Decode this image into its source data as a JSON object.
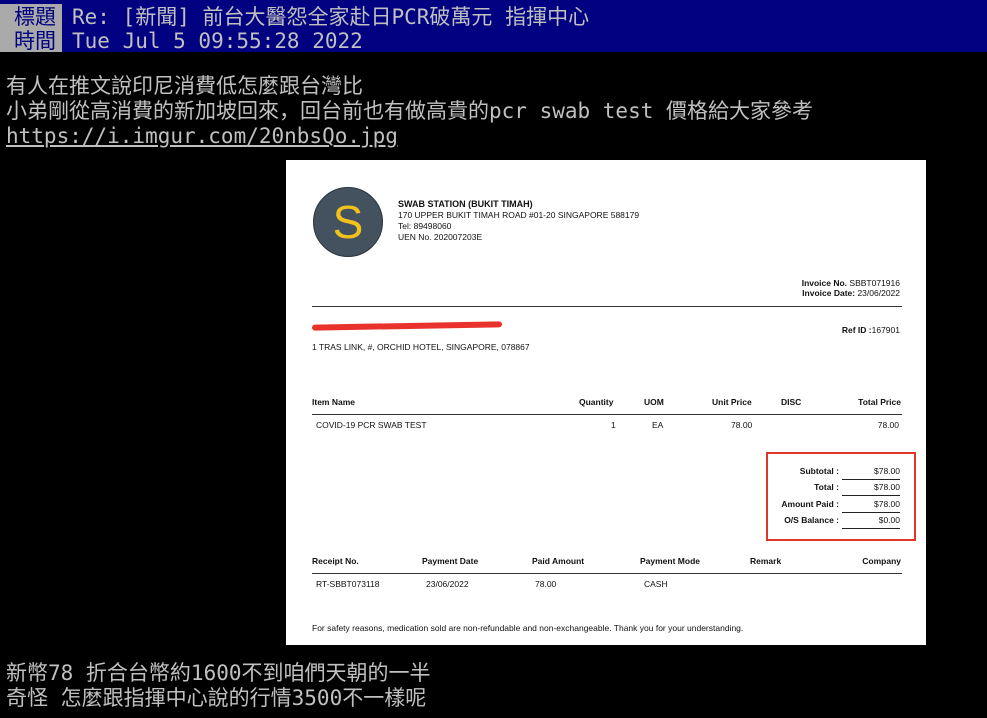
{
  "header": {
    "partial_row": "                              ",
    "title_key": "標題",
    "title_value": "Re: [新聞] 前台大醫怨全家赴日PCR破萬元  指揮中心",
    "time_key": "時間",
    "time_value": "Tue Jul  5 09:55:28 2022"
  },
  "post": {
    "line1": "有人在推文說印尼消費低怎麼跟台灣比",
    "line2": "小弟剛從高消費的新加坡回來，回台前也有做高貴的pcr swab test 價格給大家參考",
    "link": "https://i.imgur.com/20nbsQo.jpg",
    "line4": "新幣78 折合台幣約1600不到咱們天朝的一半",
    "line5": "奇怪 怎麼跟指揮中心說的行情3500不一樣呢"
  },
  "invoice": {
    "logo_letter": "S",
    "company_name": "SWAB STATION (BUKIT TIMAH)",
    "company_address": "170 UPPER BUKIT TIMAH ROAD #01-20 SINGAPORE 588179",
    "company_tel": "Tel: 89498060",
    "company_uen": "UEN No. 202007203E",
    "invoice_no_label": "Invoice No.",
    "invoice_no": "SBBT071916",
    "invoice_date_label": "Invoice Date:",
    "invoice_date": "23/06/2022",
    "ref_label": "Ref ID :",
    "ref_id": "167901",
    "customer_address": "1 TRAS LINK, #, ORCHID HOTEL, SINGAPORE, 078867",
    "item_headers": [
      "Item Name",
      "Quantity",
      "UOM",
      "Unit Price",
      "DISC",
      "Total Price"
    ],
    "item_row": [
      "COVID-19 PCR SWAB TEST",
      "1",
      "EA",
      "78.00",
      "",
      "78.00"
    ],
    "totals": [
      {
        "label": "Subtotal :",
        "value": "$78.00"
      },
      {
        "label": "Total :",
        "value": "$78.00"
      },
      {
        "label": "Amount Paid :",
        "value": "$78.00"
      },
      {
        "label": "O/S Balance :",
        "value": "$0.00"
      }
    ],
    "receipt_headers": [
      "Receipt No.",
      "Payment Date",
      "Paid Amount",
      "Payment Mode",
      "Remark",
      "Company"
    ],
    "receipt_row": [
      "RT-SBBT073118",
      "23/06/2022",
      "78.00",
      "CASH",
      "",
      ""
    ],
    "footnote": "For safety reasons, medication sold are non-refundable and non-exchangeable. Thank you for your understanding.",
    "highlight_color": "#e0352b"
  }
}
